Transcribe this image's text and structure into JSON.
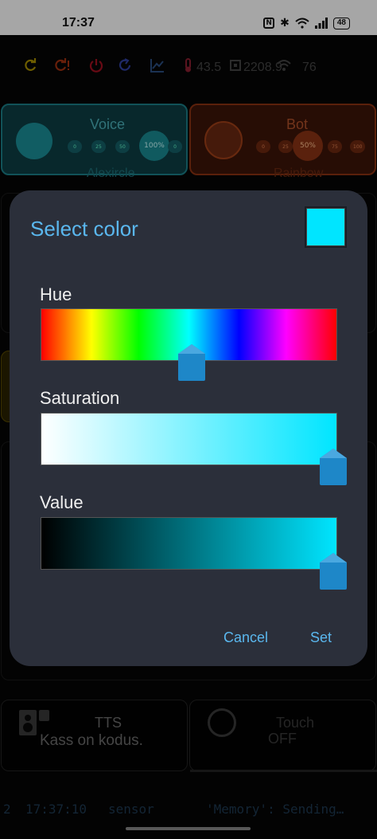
{
  "status_bar": {
    "time": "17:37",
    "nfc_label": "N",
    "battery": "48"
  },
  "toolbar": {
    "temperature": "43.5",
    "cpu": "2208.9",
    "wifi": "76"
  },
  "cards": {
    "voice": {
      "title": "Voice",
      "subtitle": "Alexircle",
      "level_options": [
        "0",
        "25",
        "50",
        "100%",
        "0"
      ],
      "level_selected": "100%"
    },
    "bot": {
      "title": "Bot",
      "subtitle": "Rainbow",
      "level_options": [
        "0",
        "25",
        "50%",
        "75",
        "100"
      ],
      "level_selected": "50%"
    },
    "tts": {
      "title": "TTS",
      "text": "Kass on kodus."
    },
    "touch": {
      "title": "Touch",
      "state": "OFF"
    }
  },
  "log_line": {
    "index": "2",
    "time": "17:37:10",
    "source": "sensor",
    "message": "'Memory': Sending…"
  },
  "dialog": {
    "title": "Select color",
    "selected_color": "#00e5ff",
    "hue": {
      "label": "Hue",
      "value_fraction": 0.51
    },
    "saturation": {
      "label": "Saturation",
      "value_fraction": 1.0
    },
    "value": {
      "label": "Value",
      "value_fraction": 1.0
    },
    "cancel_label": "Cancel",
    "set_label": "Set"
  },
  "colors": {
    "accent": "#5ab7ee",
    "dialog_bg": "#2b2f3a",
    "thumb": "#1e87c8"
  },
  "icons": [
    "refresh-icon",
    "restart-icon",
    "power-icon",
    "sync-icon",
    "chart-icon",
    "thermometer-icon",
    "cpu-icon",
    "wifi-icon",
    "tts-speaker-icon",
    "touch-ring-icon"
  ]
}
